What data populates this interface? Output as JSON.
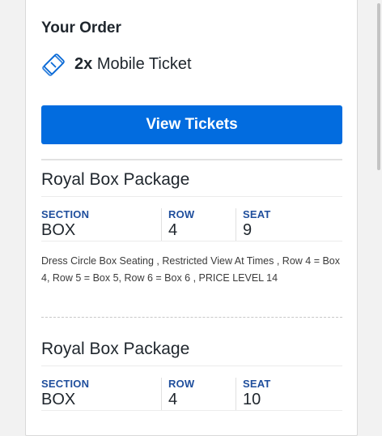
{
  "order": {
    "title": "Your Order",
    "ticket_count": "2x",
    "ticket_type": "Mobile Ticket",
    "view_button": "View Tickets"
  },
  "packages": [
    {
      "name": "Royal Box Package",
      "section_label": "SECTION",
      "section_value": "BOX",
      "row_label": "ROW",
      "row_value": "4",
      "seat_label": "SEAT",
      "seat_value": "9",
      "description": "Dress Circle Box Seating , Restricted View At Times , Row 4 = Box 4, Row 5 = Box 5, Row 6 = Box 6 , PRICE LEVEL 14"
    },
    {
      "name": "Royal Box Package",
      "section_label": "SECTION",
      "section_value": "BOX",
      "row_label": "ROW",
      "row_value": "4",
      "seat_label": "SEAT",
      "seat_value": "10"
    }
  ],
  "colors": {
    "accent": "#026cdf",
    "label": "#1f4e9c",
    "text": "#1f262d"
  },
  "icons": {
    "ticket": "mobile-ticket-icon"
  }
}
